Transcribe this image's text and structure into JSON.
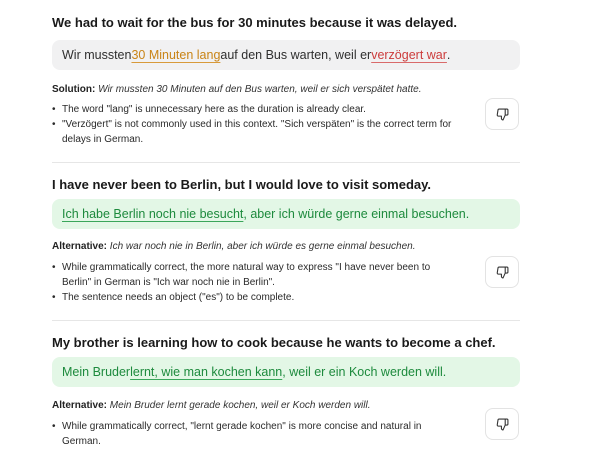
{
  "sections": [
    {
      "prompt": "We had to wait for the bus for 30 minutes because it was delayed.",
      "answer_parts": [
        "Wir mussten ",
        "30 Minuten lang",
        " auf den Bus warten, weil er ",
        "verzögert war",
        "."
      ],
      "label": "Solution:",
      "suggestion": "Wir mussten 30 Minuten auf den Bus warten, weil er sich verspätet hatte.",
      "notes": [
        "The word \"lang\" is unnecessary here as the duration is already clear.",
        "\"Verzögert\" is not commonly used in this context. \"Sich verspäten\" is the correct term for",
        "delays in German."
      ]
    },
    {
      "prompt": "I have never been to Berlin, but I would love to visit someday.",
      "answer_parts": [
        "Ich habe Berlin noch nie besucht",
        ", aber ich würde gerne einmal besuchen."
      ],
      "label": "Alternative:",
      "suggestion": "Ich war noch nie in Berlin, aber ich würde es gerne einmal besuchen.",
      "notes": [
        "While grammatically correct, the more natural way to express \"I have never been to",
        "Berlin\" in German is \"Ich war noch nie in Berlin\".",
        "The sentence needs an object (\"es\") to be complete."
      ]
    },
    {
      "prompt": "My brother is learning how to cook because he wants to become a chef.",
      "answer_parts": [
        "Mein Bruder ",
        "lernt, wie man kochen kann",
        ", weil er ein Koch werden will."
      ],
      "label": "Alternative:",
      "suggestion": "Mein Bruder lernt gerade kochen, weil er Koch werden will.",
      "notes": [
        "While grammatically correct, \"lernt gerade kochen\" is more concise and natural in",
        "German."
      ]
    }
  ],
  "icons": {
    "feedback": "thumbs-down-icon"
  },
  "colors": {
    "correct_bg": "#e3f7e6",
    "correct_text": "#1d8a3d",
    "neutral_bg": "#f1f1f2",
    "warn": "#c98416",
    "error": "#cc3b3b"
  }
}
